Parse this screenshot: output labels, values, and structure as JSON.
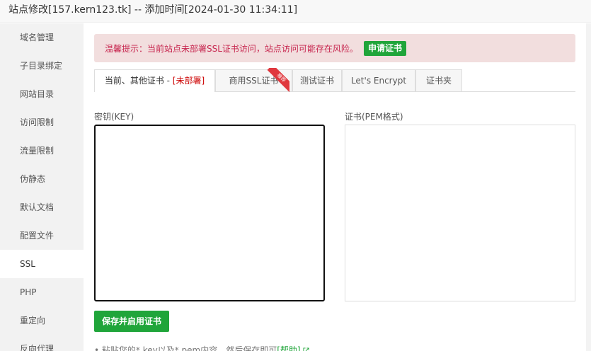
{
  "window": {
    "title": "站点修改[157.kern123.tk] -- 添加时间[2024-01-30 11:34:11]"
  },
  "sidebar": {
    "items": [
      {
        "label": "域名管理"
      },
      {
        "label": "子目录绑定"
      },
      {
        "label": "网站目录"
      },
      {
        "label": "访问限制"
      },
      {
        "label": "流量限制"
      },
      {
        "label": "伪静态"
      },
      {
        "label": "默认文档"
      },
      {
        "label": "配置文件"
      },
      {
        "label": "SSL",
        "active": true
      },
      {
        "label": "PHP"
      },
      {
        "label": "重定向"
      },
      {
        "label": "反向代理"
      }
    ]
  },
  "alert": {
    "text": "温馨提示：当前站点未部署SSL证书访问，站点访问可能存在风险。",
    "button_label": "申请证书"
  },
  "tabs": [
    {
      "label": "当前、其他证书 - ",
      "status": "[未部署]",
      "active": true
    },
    {
      "label": "商用SSL证书",
      "badge": "推荐"
    },
    {
      "label": "测试证书"
    },
    {
      "label": "Let's Encrypt"
    },
    {
      "label": "证书夹"
    }
  ],
  "form": {
    "key_label": "密钥(KEY)",
    "key_value": "",
    "pem_label": "证书(PEM格式)",
    "pem_value": "",
    "save_label": "保存并启用证书"
  },
  "tip": {
    "text": "• 粘贴您的*.key以及*.pem内容，然后保存即可",
    "link": "[帮助]",
    "icon": "external-link-icon"
  },
  "colors": {
    "accent": "#20a53a",
    "alert_bg": "#f2dede",
    "alert_text": "#c7254e",
    "badge": "#e0383e"
  }
}
